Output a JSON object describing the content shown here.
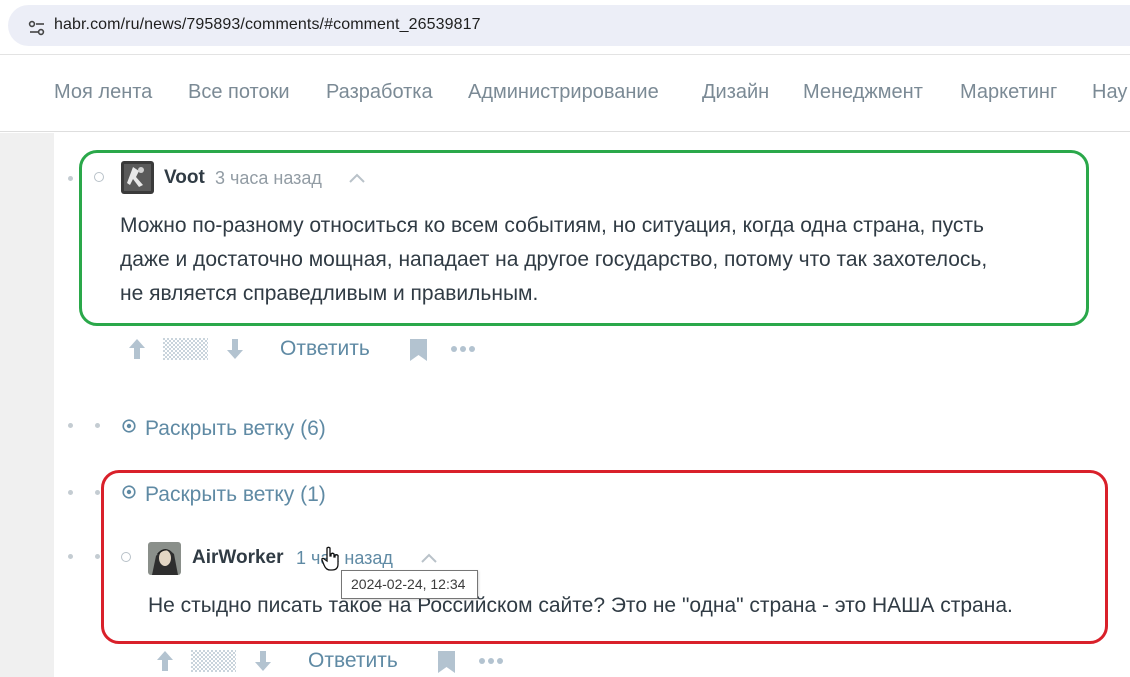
{
  "browser": {
    "url": "habr.com/ru/news/795893/comments/#comment_26539817",
    "site_info_icon": "site-settings-icon"
  },
  "nav": {
    "items": [
      "Моя лента",
      "Все потоки",
      "Разработка",
      "Администрирование",
      "Дизайн",
      "Менеджмент",
      "Маркетинг",
      "Нау"
    ]
  },
  "comment1": {
    "username": "Voot",
    "time": "3 часа назад",
    "lines": [
      "Можно по-разному относиться ко всем событиям, но ситуация, когда одна страна, пусть",
      "даже и достаточно мощная, нападает на другое государство, потому что так захотелось,",
      "не является справедливым и правильным."
    ],
    "reply_label": "Ответить"
  },
  "thread1": {
    "label": "Раскрыть ветку (6)"
  },
  "thread2": {
    "label": "Раскрыть ветку (1)"
  },
  "comment2": {
    "username": "AirWorker",
    "time": "1 час назад",
    "text": "Не стыдно писать такое на Российском сайте? Это не \"одна\" страна - это НАША страна.",
    "reply_label": "Ответить",
    "tooltip": "2024-02-24, 12:34"
  },
  "colors": {
    "highlight_green": "#2aa84a",
    "highlight_red": "#d9202a",
    "link": "#5f8aa4",
    "text": "#303b44"
  }
}
